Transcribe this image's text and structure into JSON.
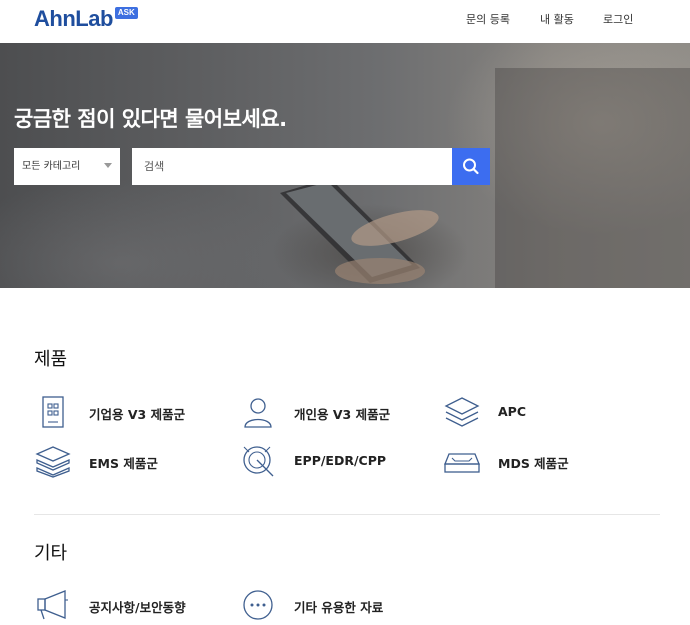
{
  "header": {
    "logo_text": "AhnLab",
    "logo_badge": "ASK",
    "nav": [
      "문의 등록",
      "내 활동",
      "로그인"
    ]
  },
  "hero": {
    "title": "궁금한 점이 있다면 물어보세요.",
    "category": "모든 카테고리",
    "search_placeholder": "검색"
  },
  "sections": {
    "products_title": "제품",
    "products": [
      {
        "label": "기업용 V3 제품군",
        "icon": "building-icon"
      },
      {
        "label": "개인용 V3 제품군",
        "icon": "person-icon"
      },
      {
        "label": "APC",
        "icon": "layers-icon"
      },
      {
        "label": "EMS 제품군",
        "icon": "stack-icon"
      },
      {
        "label": "EPP/EDR/CPP",
        "icon": "radar-icon"
      },
      {
        "label": "MDS 제품군",
        "icon": "tray-icon"
      }
    ],
    "other_title": "기타",
    "other": [
      {
        "label": "공지사항/보안동향",
        "icon": "megaphone-icon"
      },
      {
        "label": "기타 유용한 자료",
        "icon": "more-icon"
      }
    ]
  },
  "colors": {
    "accent": "#3c6df0",
    "logo": "#1f4e9e",
    "icon_stroke": "#3f5f8f"
  }
}
